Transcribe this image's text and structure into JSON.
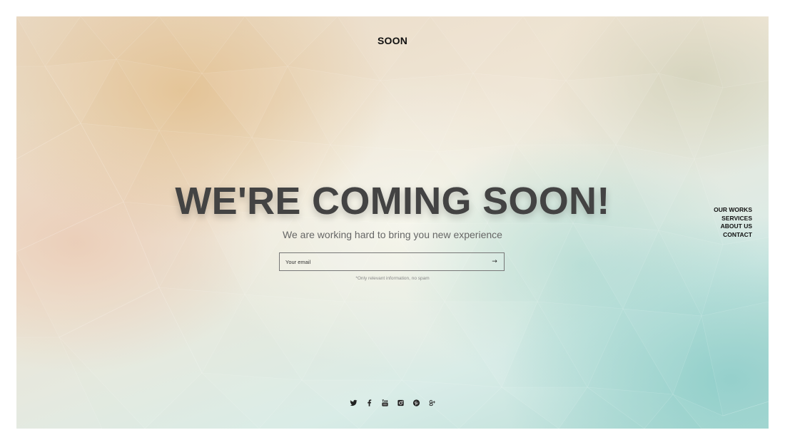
{
  "header": {
    "logo": "SOON"
  },
  "nav": {
    "items": [
      {
        "label": "OUR WORKS"
      },
      {
        "label": "SERVICES"
      },
      {
        "label": "ABOUT US"
      },
      {
        "label": "CONTACT"
      }
    ]
  },
  "hero": {
    "title": "WE'RE COMING SOON!",
    "subtitle": "We are working hard to bring you new experience"
  },
  "subscribe": {
    "placeholder": "Your email",
    "submit_label": "→",
    "note": "*Only relevant information, no spam"
  },
  "social": {
    "icons": [
      "twitter-icon",
      "facebook-icon",
      "youtube-icon",
      "instagram-icon",
      "pinterest-icon",
      "google-plus-icon"
    ]
  },
  "colors": {
    "headline": "#434343",
    "text": "#111111",
    "muted": "#666666"
  }
}
